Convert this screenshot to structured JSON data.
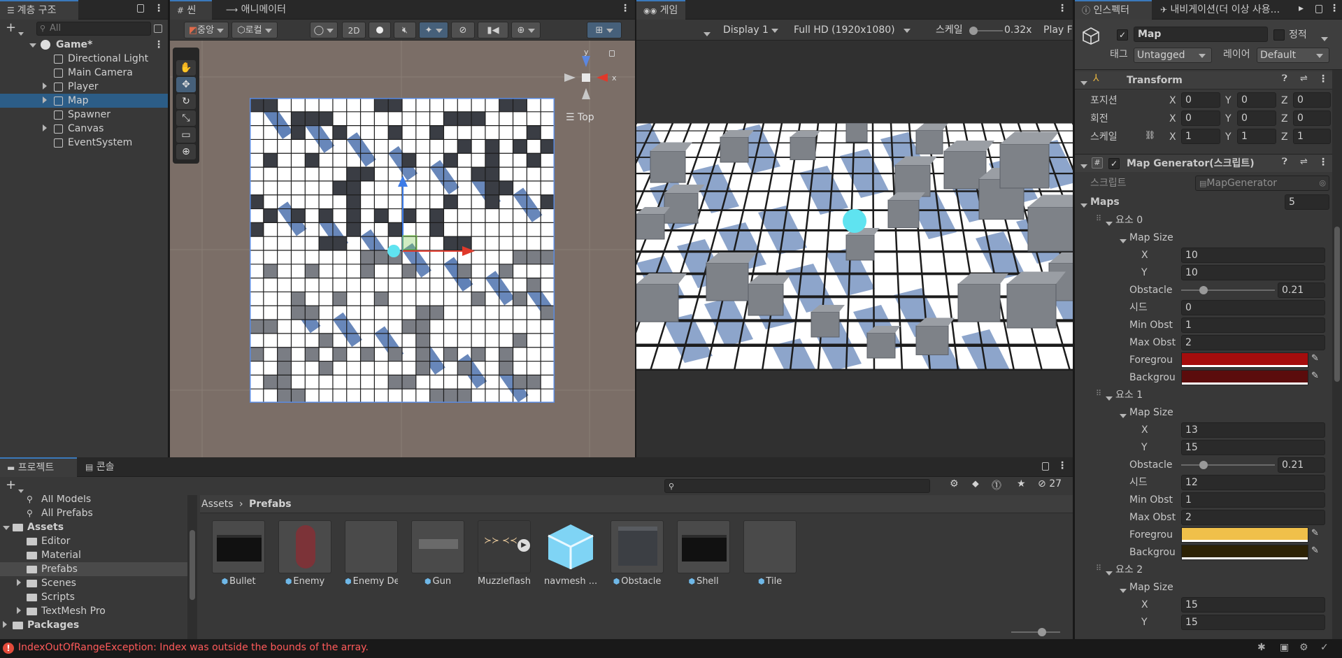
{
  "hierarchy": {
    "tab_label": "계층 구조",
    "add_label": "+",
    "search_placeholder": "All",
    "scene_name": "Game*",
    "items": [
      {
        "label": "Directional Light",
        "indent": 1,
        "expandable": false,
        "selected": false
      },
      {
        "label": "Main Camera",
        "indent": 1,
        "expandable": false,
        "selected": false
      },
      {
        "label": "Player",
        "indent": 1,
        "expandable": true,
        "selected": false
      },
      {
        "label": "Map",
        "indent": 1,
        "expandable": true,
        "selected": true
      },
      {
        "label": "Spawner",
        "indent": 1,
        "expandable": false,
        "selected": false
      },
      {
        "label": "Canvas",
        "indent": 1,
        "expandable": true,
        "selected": false
      },
      {
        "label": "EventSystem",
        "indent": 1,
        "expandable": false,
        "selected": false
      }
    ]
  },
  "scene": {
    "tab_label": "씬",
    "animator_tab_label": "애니메이터",
    "pivot_label": "중앙",
    "space_label": "로컬",
    "mode_2d_label": "2D",
    "gizmo_view_label": "Top",
    "gizmo_axis_y": "y",
    "gizmo_axis_x": "x",
    "tools": [
      "hand-tool",
      "move-tool",
      "rotate-tool",
      "scale-tool",
      "rect-tool",
      "transform-tool"
    ],
    "grid_cols": 22,
    "grid_rows": 22
  },
  "game": {
    "tab_label": "게임",
    "display_label": "Display 1",
    "resolution_label": "Full HD (1920x1080)",
    "scale_label": "스케일",
    "scale_value": "0.32x",
    "play_label": "Play F"
  },
  "inspector": {
    "tab_label": "인스펙터",
    "nav_tab_label": "내비게이션(더 이상 사용...",
    "object_name": "Map",
    "static_label": "정적",
    "tag_label": "태그",
    "tag_value": "Untagged",
    "layer_label": "레이어",
    "layer_value": "Default",
    "transform": {
      "title": "Transform",
      "position_label": "포지션",
      "rotation_label": "회전",
      "scale_label": "스케일",
      "position": [
        "0",
        "0",
        "0"
      ],
      "rotation": [
        "0",
        "0",
        "0"
      ],
      "scale": [
        "1",
        "1",
        "1"
      ],
      "axes": [
        "X",
        "Y",
        "Z"
      ]
    },
    "map_generator": {
      "title": "Map Generator(스크립트)",
      "script_label": "스크립트",
      "script_value": "MapGenerator",
      "maps_label": "Maps",
      "maps_count": "5",
      "elements": [
        {
          "label": "요소 0",
          "map_size_label": "Map Size",
          "x": "10",
          "y": "10",
          "obstacle_label": "Obstacle",
          "obstacle": "0.21",
          "obstacle_fraction": 0.21,
          "seed_label": "시드",
          "seed": "0",
          "min_label": "Min Obst",
          "min": "1",
          "max_label": "Max Obst",
          "max": "2",
          "fg_label": "Foregrou",
          "fg_color": "#a50d0d",
          "bg_label": "Backgrou",
          "bg_color": "#5b0c0c"
        },
        {
          "label": "요소 1",
          "map_size_label": "Map Size",
          "x": "13",
          "y": "15",
          "obstacle_label": "Obstacle",
          "obstacle": "0.21",
          "obstacle_fraction": 0.21,
          "seed_label": "시드",
          "seed": "12",
          "min_label": "Min Obst",
          "min": "1",
          "max_label": "Max Obst",
          "max": "2",
          "fg_label": "Foregrou",
          "fg_color": "#f0c04a",
          "bg_label": "Backgrou",
          "bg_color": "#2d2205"
        },
        {
          "label": "요소 2",
          "map_size_label": "Map Size",
          "x": "15",
          "y": "15"
        }
      ]
    }
  },
  "project": {
    "tab_label": "프로젝트",
    "console_tab_label": "콘솔",
    "hidden_count": "27",
    "tree": [
      {
        "label": "All Models",
        "indent": 1,
        "kind": "search"
      },
      {
        "label": "All Prefabs",
        "indent": 1,
        "kind": "search"
      },
      {
        "label": "Assets",
        "indent": 0,
        "kind": "folder-open"
      },
      {
        "label": "Editor",
        "indent": 1,
        "kind": "folder"
      },
      {
        "label": "Material",
        "indent": 1,
        "kind": "folder"
      },
      {
        "label": "Prefabs",
        "indent": 1,
        "kind": "folder",
        "selected": true
      },
      {
        "label": "Scenes",
        "indent": 1,
        "kind": "folder",
        "expandable": true
      },
      {
        "label": "Scripts",
        "indent": 1,
        "kind": "folder"
      },
      {
        "label": "TextMesh Pro",
        "indent": 1,
        "kind": "folder",
        "expandable": true
      },
      {
        "label": "Packages",
        "indent": 0,
        "kind": "folder"
      }
    ],
    "breadcrumb_root": "Assets",
    "breadcrumb_current": "Prefabs",
    "assets": [
      {
        "label": "Bullet",
        "thumb": "dark-box"
      },
      {
        "label": "Enemy",
        "thumb": "capsule"
      },
      {
        "label": "Enemy De...",
        "thumb": "empty"
      },
      {
        "label": "Gun",
        "thumb": "gun"
      },
      {
        "label": "Muzzleflash",
        "thumb": "muzzle"
      },
      {
        "label": "navmesh ...",
        "thumb": "big-cube"
      },
      {
        "label": "Obstacle",
        "thumb": "grey-box"
      },
      {
        "label": "Shell",
        "thumb": "dark-box"
      },
      {
        "label": "Tile",
        "thumb": "empty"
      }
    ]
  },
  "status": {
    "error_text": "IndexOutOfRangeException: Index was outside the bounds of the array."
  },
  "colors": {
    "accent": "#3a79bb",
    "selection": "#2c5d87",
    "error": "#ff5a5a"
  }
}
